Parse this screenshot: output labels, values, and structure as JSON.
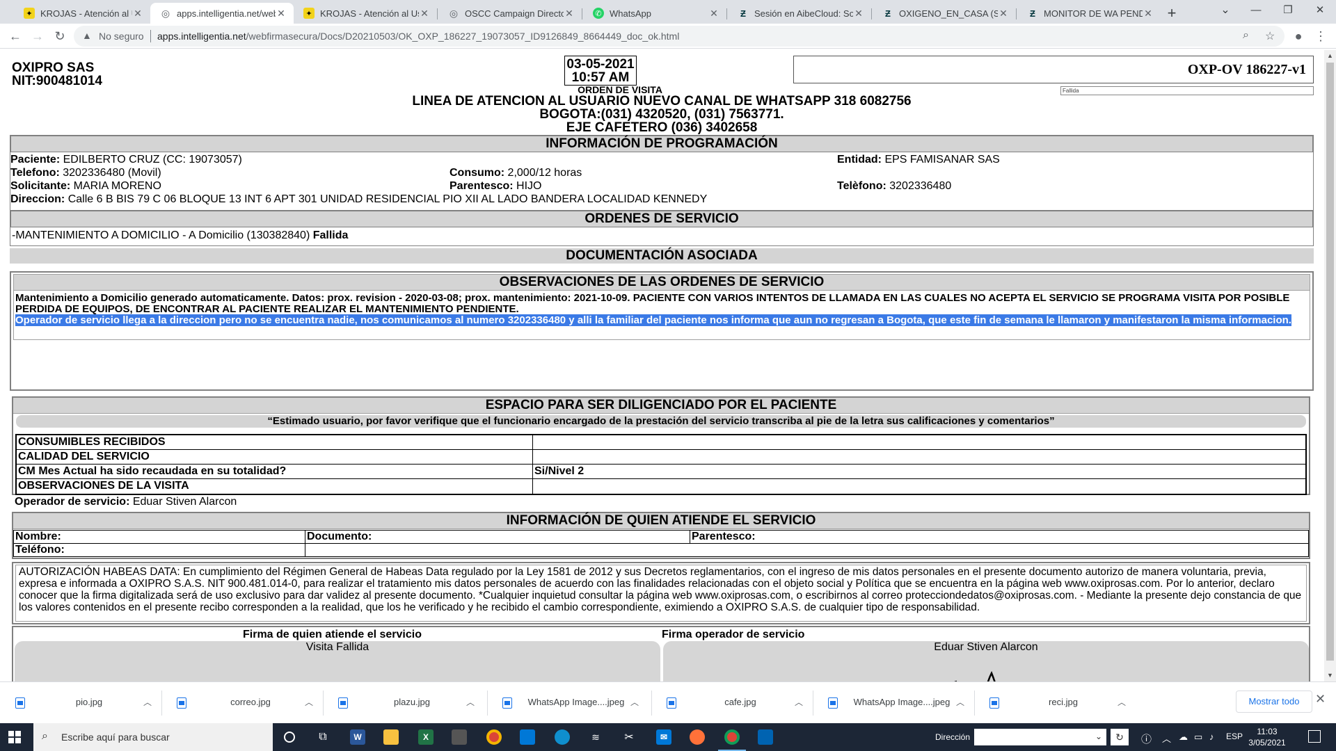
{
  "browser": {
    "tabs": [
      {
        "title": "KROJAS - Atención al Usua",
        "favicon": "krojas-icon",
        "active": false
      },
      {
        "title": "apps.intelligentia.net/webf",
        "favicon": "globe-icon",
        "active": true
      },
      {
        "title": "KROJAS - Atención al Usua",
        "favicon": "krojas-icon",
        "active": false
      },
      {
        "title": "OSCC Campaign Director -",
        "favicon": "globe-icon",
        "active": false
      },
      {
        "title": "WhatsApp",
        "favicon": "whatsapp-icon",
        "active": false
      },
      {
        "title": "Sesión en AibeCloud: Sopo",
        "favicon": "zendesk-icon",
        "active": false
      },
      {
        "title": "OXIGENO_EN_CASA (Sopo",
        "favicon": "zendesk-icon",
        "active": false
      },
      {
        "title": "MONITOR DE WA PENDIEN",
        "favicon": "zendesk-icon",
        "active": false
      }
    ],
    "insecure_label": "No seguro",
    "url_host": "apps.intelligentia.net",
    "url_path": "/webfirmasecura/Docs/D20210503/OK_OXP_186227_19073057_ID9126849_8664449_doc_ok.html",
    "accent": "#1a73e8"
  },
  "doc": {
    "company": "OXIPRO SAS",
    "nit": "NIT:900481014",
    "date": "03-05-2021",
    "time": "10:57 AM",
    "order_label": "ORDEN DE VISITA",
    "line1": "LINEA DE ATENCION AL USUARIO NUEVO CANAL DE WHATSAPP 318 6082756",
    "line2": "BOGOTA:(031) 4320520, (031) 7563771.",
    "line3": "EJE CAFETERO (036) 3402658",
    "code": "OXP-OV 186227-v1",
    "status_small": "Fallida",
    "prog": {
      "title": "INFORMACIÓN DE PROGRAMACIÓN",
      "paciente_k": "Paciente:",
      "paciente_v": " EDILBERTO CRUZ (CC: 19073057)",
      "entidad_k": "Entidad:",
      "entidad_v": " EPS FAMISANAR SAS",
      "telefono_k": "Telefono:",
      "telefono_v": " 3202336480 (Movil)",
      "consumo_k": "Consumo:",
      "consumo_v": " 2,000/12 horas",
      "solicitante_k": "Solicitante:",
      "solicitante_v": " MARIA MORENO",
      "parentesco_k": "Parentesco:",
      "parentesco_v": " HIJO",
      "telefono2_k": "Telèfono:",
      "telefono2_v": " 3202336480",
      "direccion_k": "Direccion:",
      "direccion_v": " Calle 6 B BIS 79 C 06 BLOQUE 13 INT 6 APT 301 UNIDAD RESIDENCIAL PIO XII AL LADO BANDERA LOCALIDAD KENNEDY"
    },
    "ordenes": {
      "title": "ORDENES DE SERVICIO",
      "item": "-MANTENIMIENTO A DOMICILIO - A Domicilio (130382840) ",
      "status": "Fallida"
    },
    "doc_asociada": "DOCUMENTACIÓN ASOCIADA",
    "obs": {
      "title": "OBSERVACIONES DE LAS ORDENES DE SERVICIO",
      "text1": "Mantenimiento a Domicilio generado automaticamente. Datos: prox. revision - 2020-03-08; prox. mantenimiento: 2021-10-09. PACIENTE CON VARIOS INTENTOS DE LLAMADA EN LAS CUALES NO ACEPTA EL SERVICIO SE PROGRAMA VISITA POR POSIBLE PERDIDA DE EQUIPOS, DE ENCONTRAR AL PACIENTE REALIZAR EL MANTENIMIENTO PENDIENTE.",
      "text2": "Operador de servicio llega a la direccion pero no se encuentra nadie, nos comunicamos al numero 3202336480 y alli la familiar del paciente nos informa que aun no regresan a Bogota, que este fin de semana le llamaron y manifestaron la misma informacion."
    },
    "espacio": {
      "title": "ESPACIO PARA SER DILIGENCIADO POR EL PACIENTE",
      "quote": "“Estimado usuario, por favor verifique que el funcionario encargado de la prestación del servicio transcriba al pie de la letra sus calificaciones y comentarios”",
      "rows": [
        {
          "k": "CONSUMIBLES RECIBIDOS",
          "v": ""
        },
        {
          "k": "CALIDAD DEL SERVICIO",
          "v": ""
        },
        {
          "k": "CM Mes Actual ha sido recaudada en su totalidad?",
          "v": "Si/Nivel 2"
        },
        {
          "k": "OBSERVACIONES DE LA VISITA",
          "v": ""
        }
      ],
      "operador_k": "Operador de servicio:",
      "operador_v": " Eduar Stiven Alarcon"
    },
    "info": {
      "title": "INFORMACIÓN DE QUIEN ATIENDE EL SERVICIO",
      "nombre": "Nombre:",
      "documento": "Documento:",
      "parentesco": "Parentesco:",
      "telefono": "Teléfono:"
    },
    "habeas": "AUTORIZACIÓN HABEAS DATA: En cumplimiento del Régimen General de Habeas Data regulado por la Ley 1581 de 2012 y sus Decretos reglamentarios, con el ingreso de mis datos personales en el presente documento autorizo de manera voluntaria, previa, expresa e informada a OXIPRO S.A.S. NIT 900.481.014-0, para realizar el tratamiento mis datos personales de acuerdo con las finalidades relacionadas con el objeto social y Política que se encuentra en la página web www.oxiprosas.com. Por lo anterior, declaro conocer que la firma digitalizada será de uso exclusivo para dar validez al presente documento. *Cualquier inquietud consultar la página web www.oxiprosas.com, o escribirnos al correo protecciondedatos@oxiprosas.com. - Mediante la presente dejo constancia de que los valores contenidos en el presente recibo corresponden a la realidad, que los he verificado y he recibido el cambio correspondiente, eximiendo a OXIPRO S.A.S. de cualquier tipo de responsabilidad.",
    "firma1_lbl": "Firma de quien atiende el servicio",
    "firma1_val": "Visita Fallida",
    "firma2_lbl": "Firma operador de servicio",
    "firma2_val": "Eduar Stiven Alarcon",
    "signature_text": "EA"
  },
  "downloads": {
    "items": [
      "pio.jpg",
      "correo.jpg",
      "plazu.jpg",
      "WhatsApp Image....jpeg",
      "cafe.jpg",
      "WhatsApp Image....jpeg",
      "reci.jpg"
    ],
    "show_all": "Mostrar todo"
  },
  "taskbar": {
    "search_placeholder": "Escribe aquí para buscar",
    "direccion_label": "Dirección",
    "lang": "ESP",
    "time": "11:03",
    "date": "3/05/2021"
  }
}
